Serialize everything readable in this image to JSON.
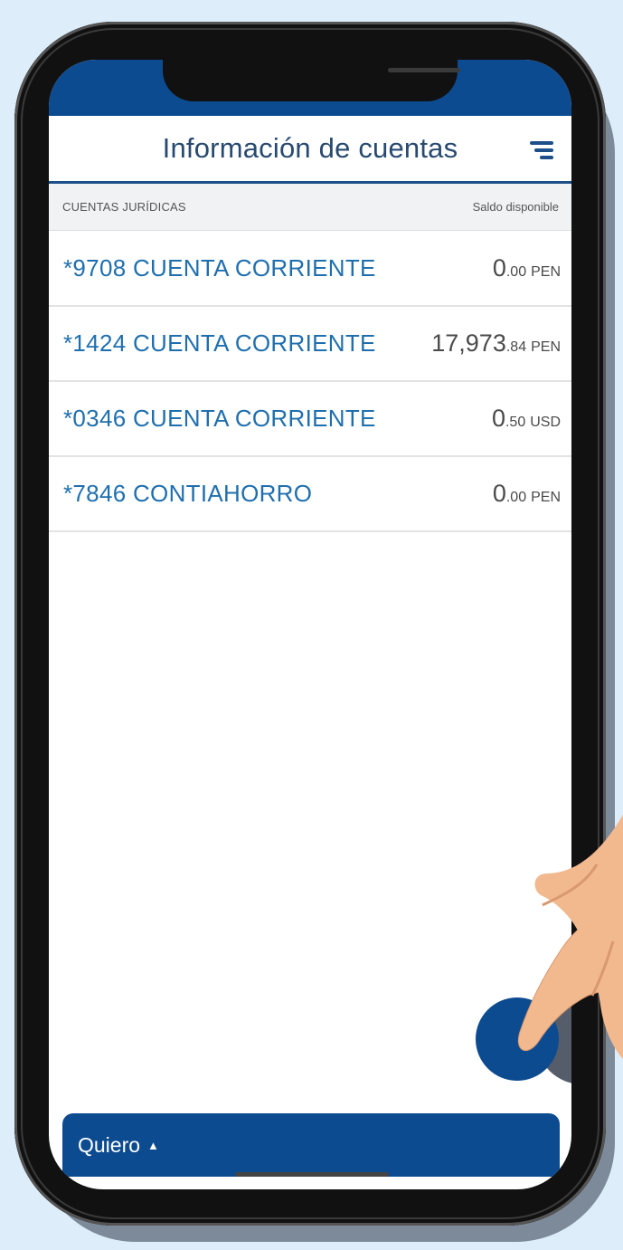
{
  "header": {
    "title": "Información de cuentas",
    "menu_icon": "hamburger-menu-icon"
  },
  "section": {
    "label": "CUENTAS JURÍDICAS",
    "balance_label": "Saldo disponible"
  },
  "accounts": [
    {
      "name": "*9708 CUENTA CORRIENTE",
      "balance_int": "0",
      "balance_dec": ".00",
      "currency": "PEN"
    },
    {
      "name": "*1424 CUENTA CORRIENTE",
      "balance_int": "17,973",
      "balance_dec": ".84",
      "currency": "PEN"
    },
    {
      "name": "*0346 CUENTA CORRIENTE",
      "balance_int": "0",
      "balance_dec": ".50",
      "currency": "USD"
    },
    {
      "name": "*7846 CONTIAHORRO",
      "balance_int": "0",
      "balance_dec": ".00",
      "currency": "PEN"
    }
  ],
  "action_bar": {
    "label": "Quiero",
    "caret": "▲"
  },
  "colors": {
    "brand_blue": "#0d4b91",
    "link_blue": "#1f6fae",
    "background": "#ddeefa"
  }
}
